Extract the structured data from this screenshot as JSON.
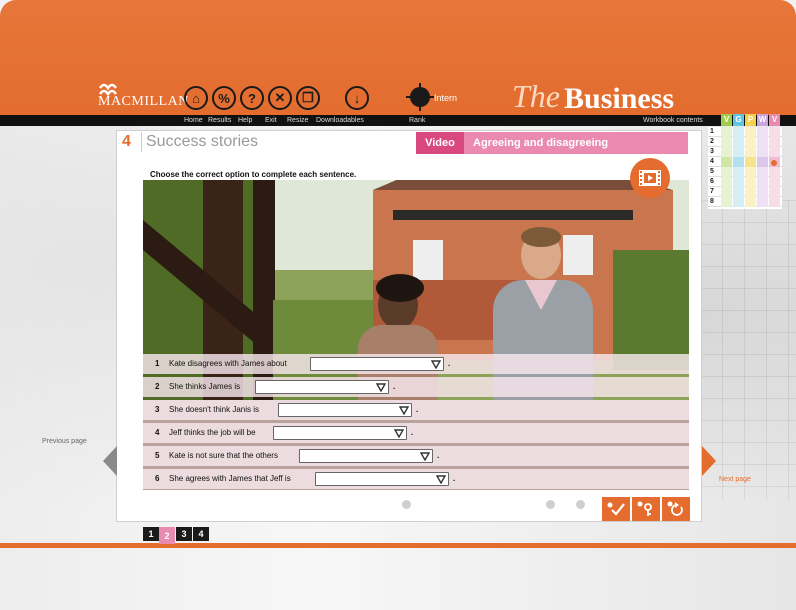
{
  "brand": {
    "publisher": "MACMILLAN",
    "title_prefix": "The",
    "title_main": "Business"
  },
  "nav_icons": [
    {
      "icon": "home-icon",
      "glyph": "⌂"
    },
    {
      "icon": "results-icon",
      "glyph": "%"
    },
    {
      "icon": "help-icon",
      "glyph": "?"
    },
    {
      "icon": "exit-icon",
      "glyph": "✕"
    },
    {
      "icon": "resize-icon",
      "glyph": "❐"
    },
    {
      "icon": "downloadables-icon",
      "glyph": "↓"
    }
  ],
  "intern": {
    "label": "Intern"
  },
  "toolbar": {
    "home": "Home",
    "results": "Results",
    "help": "Help",
    "exit": "Exit",
    "resize": "Resize",
    "downloadables": "Downloadables",
    "rank": "Rank",
    "workbook": "Workbook contents"
  },
  "workbook": {
    "columns": [
      "V",
      "G",
      "P",
      "W",
      "V"
    ],
    "column_colors": [
      "#9fcc4a",
      "#5fc6e4",
      "#f2d14c",
      "#c9a6dc",
      "#ea8ab0"
    ],
    "rows": [
      "1",
      "2",
      "3",
      "4",
      "5",
      "6",
      "7",
      "8"
    ],
    "highlight_row": "4"
  },
  "unit": {
    "number": "4",
    "title": "Success stories"
  },
  "tabs": {
    "video": "Video",
    "topic": "Agreeing and disagreeing"
  },
  "instructions": "Choose the correct option to complete each sentence.",
  "questions": [
    {
      "num": "1",
      "text": "Kate disagrees with James about",
      "end": "."
    },
    {
      "num": "2",
      "text": "She thinks James is",
      "end": "."
    },
    {
      "num": "3",
      "text": "She doesn't think Janis is",
      "end": "."
    },
    {
      "num": "4",
      "text": "Jeff thinks the job will be",
      "end": "."
    },
    {
      "num": "5",
      "text": "Kate is not sure that the others",
      "end": "."
    },
    {
      "num": "6",
      "text": "She agrees with James that Jeff is",
      "end": "."
    }
  ],
  "controls": [
    "check-icon",
    "key-icon",
    "reset-icon"
  ],
  "pages": [
    "1",
    "2",
    "3",
    "4"
  ],
  "active_page": "2",
  "side_nav": {
    "previous": "Previous page",
    "next": "Next page"
  },
  "colors": {
    "accent": "#e36c2e",
    "pink": "#d9497f",
    "pink_light": "#ea8ab0"
  }
}
